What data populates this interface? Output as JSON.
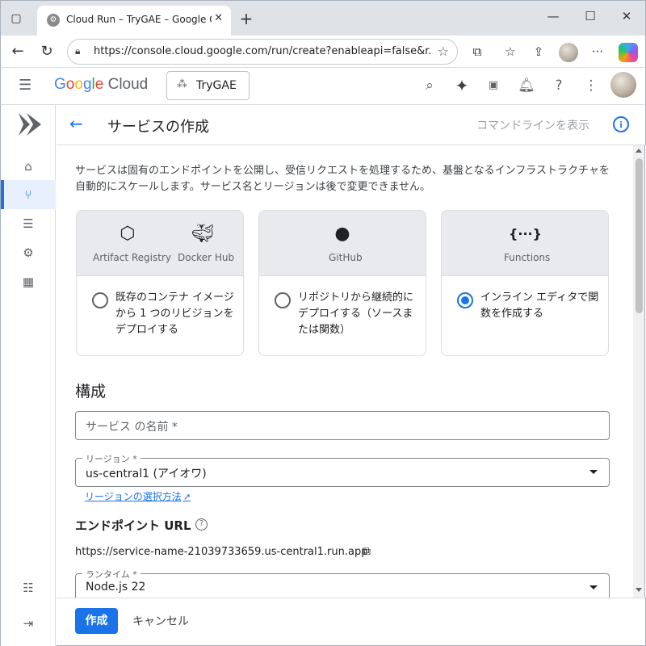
{
  "browser": {
    "tab_title": "Cloud Run – TryGAE – Google Clo",
    "url": "https://console.cloud.google.com/run/create?enableapi=false&r..."
  },
  "header": {
    "logo_parts": [
      "G",
      "o",
      "o",
      "g",
      "l",
      "e"
    ],
    "logo_suffix": "Cloud",
    "project": "TryGAE"
  },
  "page": {
    "title": "サービスの作成",
    "command_line": "コマンドラインを表示",
    "description": "サービスは固有のエンドポイントを公開し、受信リクエストを処理するため、基盤となるインフラストラクチャを自動的にスケールします。サービス名とリージョンは後で変更できません。"
  },
  "sources": [
    {
      "labels": [
        "Artifact Registry",
        "Docker Hub"
      ],
      "option": "既存のコンテナ イメージから 1 つのリビジョンをデプロイする",
      "selected": false
    },
    {
      "labels": [
        "GitHub"
      ],
      "option": "リポジトリから継続的にデプロイする（ソースまたは関数）",
      "selected": false
    },
    {
      "labels": [
        "Functions"
      ],
      "option": "インライン エディタで関数を作成する",
      "selected": true
    }
  ],
  "config": {
    "section_title": "構成",
    "service_name_placeholder": "サービス の名前 *",
    "region_label": "リージョン *",
    "region_value": "us-central1 (アイオワ)",
    "region_help": "リージョンの選択方法",
    "endpoint_title": "エンドポイント URL",
    "endpoint_url": "https://service-name-21039733659.us-central1.run.app",
    "runtime_label": "ランタイム *",
    "runtime_value": "Node.js 22"
  },
  "footer": {
    "create": "作成",
    "cancel": "キャンセル"
  },
  "colors": {
    "accent": "#1a73e8",
    "card_header_bg": "#e8eaed"
  }
}
